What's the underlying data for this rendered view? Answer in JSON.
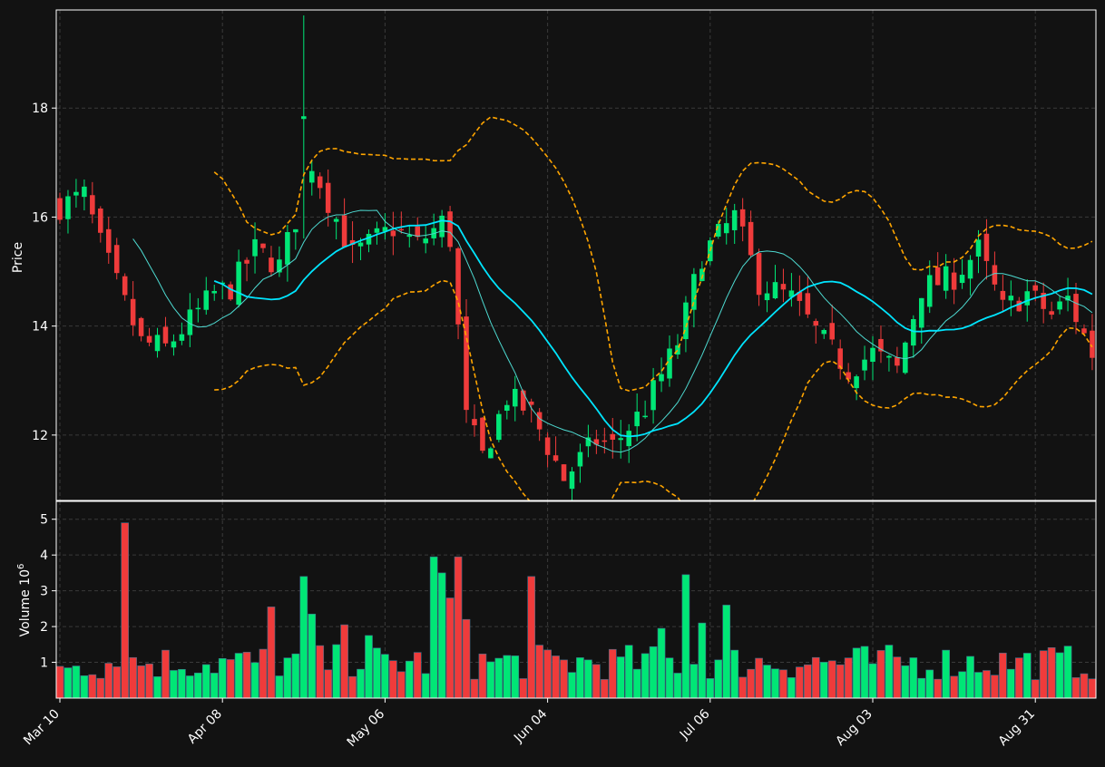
{
  "colors": {
    "background": "#121212",
    "up": "#00e676",
    "down": "#ef3b3b",
    "grid": "#3a3a3a",
    "axis_text": "#ffffff",
    "ma_slow": "#00e5ff",
    "ma_fast": "#4dd9d0",
    "band": "#ffa500"
  },
  "chart_data": {
    "type": "candlestick",
    "price_panel": {
      "ylabel": "Price",
      "yticks": [
        12,
        14,
        16,
        18
      ],
      "ylim": [
        10.8,
        19.8
      ]
    },
    "volume_panel": {
      "ylabel": "Volume  10",
      "ylabel_exponent": "6",
      "yticks": [
        1,
        2,
        3,
        4,
        5
      ],
      "ylim": [
        0,
        5.5
      ]
    },
    "x_tick_labels": [
      {
        "index": 0,
        "label": "Mar 10"
      },
      {
        "index": 20,
        "label": "Apr 08"
      },
      {
        "index": 40,
        "label": "May 06"
      },
      {
        "index": 60,
        "label": "Jun 04"
      },
      {
        "index": 80,
        "label": "Jul 06"
      },
      {
        "index": 100,
        "label": "Aug 03"
      },
      {
        "index": 120,
        "label": "Aug 31"
      }
    ],
    "x_count": 128,
    "grid": true,
    "legend": "none",
    "overlays": [
      {
        "id": "ma_slow",
        "role": "moving average (thick)"
      },
      {
        "id": "ma_fast",
        "role": "moving average (thin)"
      },
      {
        "id": "band_upper",
        "role": "upper band (dashed)"
      },
      {
        "id": "band_lower",
        "role": "lower band (dashed)"
      }
    ]
  }
}
